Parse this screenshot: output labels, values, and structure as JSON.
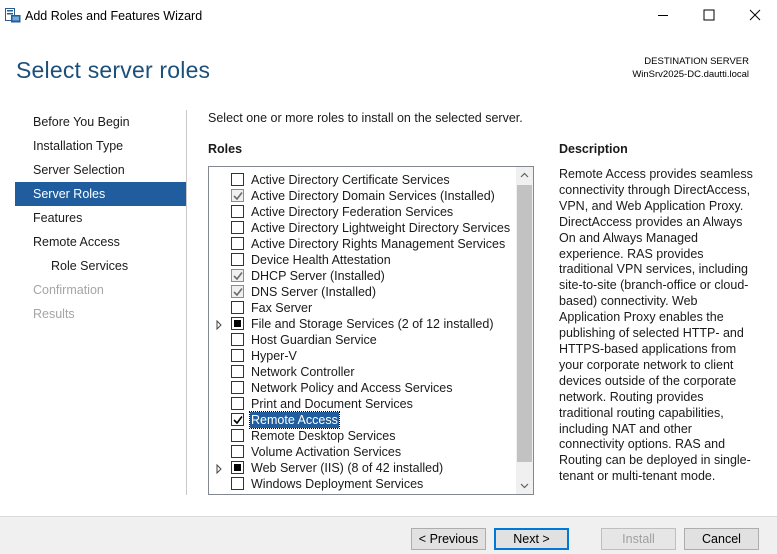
{
  "window": {
    "title": "Add Roles and Features Wizard"
  },
  "header": {
    "title": "Select server roles",
    "destination_label": "DESTINATION SERVER",
    "destination_server": "WinSrv2025-DC.dautti.local"
  },
  "nav": {
    "items": [
      {
        "label": "Before You Begin",
        "state": "normal"
      },
      {
        "label": "Installation Type",
        "state": "normal"
      },
      {
        "label": "Server Selection",
        "state": "normal"
      },
      {
        "label": "Server Roles",
        "state": "active"
      },
      {
        "label": "Features",
        "state": "normal"
      },
      {
        "label": "Remote Access",
        "state": "normal"
      },
      {
        "label": "Role Services",
        "state": "sub"
      },
      {
        "label": "Confirmation",
        "state": "disabled"
      },
      {
        "label": "Results",
        "state": "disabled"
      }
    ]
  },
  "content": {
    "instruction": "Select one or more roles to install on the selected server.",
    "roles_heading": "Roles",
    "description_heading": "Description",
    "description": "Remote Access provides seamless connectivity through DirectAccess, VPN, and Web Application Proxy. DirectAccess provides an Always On and Always Managed experience. RAS provides traditional VPN services, including site-to-site (branch-office or cloud-based) connectivity. Web Application Proxy enables the publishing of selected HTTP- and HTTPS-based applications from your corporate network to client devices outside of the corporate network. Routing provides traditional routing capabilities, including NAT and other connectivity options. RAS and Routing can be deployed in single-tenant or multi-tenant mode."
  },
  "roles": [
    {
      "label": "Active Directory Certificate Services",
      "state": "unchecked",
      "expander": false
    },
    {
      "label": "Active Directory Domain Services (Installed)",
      "state": "installed",
      "expander": false
    },
    {
      "label": "Active Directory Federation Services",
      "state": "unchecked",
      "expander": false
    },
    {
      "label": "Active Directory Lightweight Directory Services",
      "state": "unchecked",
      "expander": false
    },
    {
      "label": "Active Directory Rights Management Services",
      "state": "unchecked",
      "expander": false
    },
    {
      "label": "Device Health Attestation",
      "state": "unchecked",
      "expander": false
    },
    {
      "label": "DHCP Server (Installed)",
      "state": "installed",
      "expander": false
    },
    {
      "label": "DNS Server (Installed)",
      "state": "installed",
      "expander": false
    },
    {
      "label": "Fax Server",
      "state": "unchecked",
      "expander": false
    },
    {
      "label": "File and Storage Services (2 of 12 installed)",
      "state": "partial",
      "expander": true
    },
    {
      "label": "Host Guardian Service",
      "state": "unchecked",
      "expander": false
    },
    {
      "label": "Hyper-V",
      "state": "unchecked",
      "expander": false
    },
    {
      "label": "Network Controller",
      "state": "unchecked",
      "expander": false
    },
    {
      "label": "Network Policy and Access Services",
      "state": "unchecked",
      "expander": false
    },
    {
      "label": "Print and Document Services",
      "state": "unchecked",
      "expander": false
    },
    {
      "label": "Remote Access",
      "state": "checked",
      "expander": false,
      "selected": true
    },
    {
      "label": "Remote Desktop Services",
      "state": "unchecked",
      "expander": false
    },
    {
      "label": "Volume Activation Services",
      "state": "unchecked",
      "expander": false
    },
    {
      "label": "Web Server (IIS) (8 of 42 installed)",
      "state": "partial",
      "expander": true
    },
    {
      "label": "Windows Deployment Services",
      "state": "unchecked",
      "expander": false
    }
  ],
  "footer": {
    "previous_label": "< Previous",
    "next_label": "Next >",
    "install_label": "Install",
    "cancel_label": "Cancel"
  }
}
